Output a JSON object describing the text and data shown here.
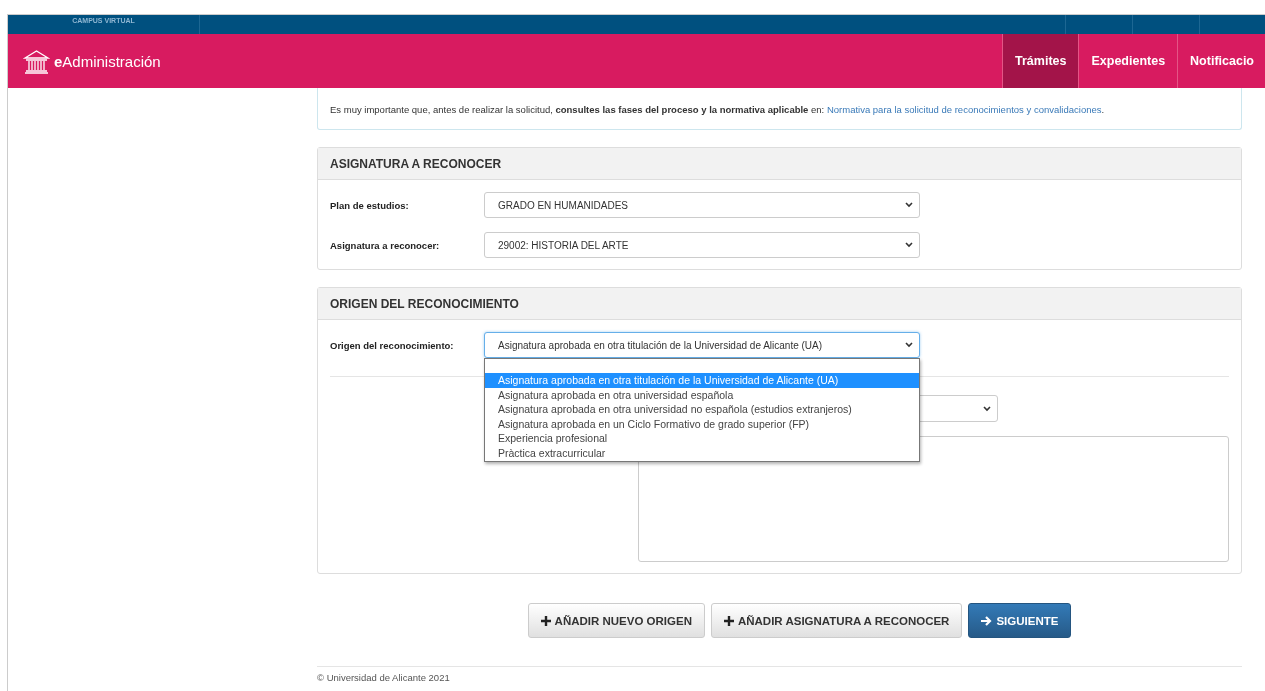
{
  "top_bar": {
    "label": "CAMPUS VIRTUAL"
  },
  "header": {
    "brand_bold": "e",
    "brand": "Administración",
    "nav": [
      {
        "label": "Trámites",
        "selected": true
      },
      {
        "label": "Expedientes",
        "selected": false
      },
      {
        "label": "Notificacio",
        "selected": false
      }
    ]
  },
  "notice": {
    "text": "Es muy importante que, antes de realizar la solicitud, **consultes las fases del proceso y la normativa aplicable** en: ",
    "link": "Normativa para la solicitud de reconocimientos y convalidaciones",
    "after": "."
  },
  "sections": [
    {
      "title": "ASIGNATURA A RECONOCER",
      "fields": [
        {
          "label": "Plan de estudios:",
          "value": "GRADO EN HUMANIDADES",
          "expanded": false
        },
        {
          "label": "Asignatura a reconocer:",
          "value": "29002: HISTORIA DEL ARTE",
          "expanded": false
        }
      ]
    },
    {
      "title": "ORIGEN DEL RECONOCIMIENTO",
      "fields": [
        {
          "label": "Origen del reconocimiento:",
          "value": "Asignatura aprobada en otra titulación de la Universidad de Alicante (UA)",
          "expanded": true,
          "options": [
            {
              "label": "Asignatura aprobada en otra titulación de la Universidad de Alicante (UA)",
              "selected": true
            },
            {
              "label": "Asignatura aprobada en otra universidad española",
              "selected": false
            },
            {
              "label": "Asignatura aprobada en otra universidad no española (estudios extranjeros)",
              "selected": false
            },
            {
              "label": "Asignatura aprobada en un Ciclo Formativo de grado superior (FP)",
              "selected": false
            },
            {
              "label": "Experiencia profesional",
              "selected": false
            },
            {
              "label": "Pràctica extracurricular",
              "selected": false
            }
          ]
        }
      ],
      "extra_fields": [
        {
          "kind": "select"
        },
        {
          "kind": "textarea"
        }
      ]
    }
  ],
  "buttons": [
    {
      "label": "AÑADIR NUEVO ORIGEN",
      "kind": "add"
    },
    {
      "label": "AÑADIR ASIGNATURA A RECONOCER",
      "kind": "add"
    },
    {
      "label": "SIGUIENTE",
      "kind": "next"
    }
  ],
  "footer": {
    "text": "© Universidad de Alicante 2021"
  }
}
